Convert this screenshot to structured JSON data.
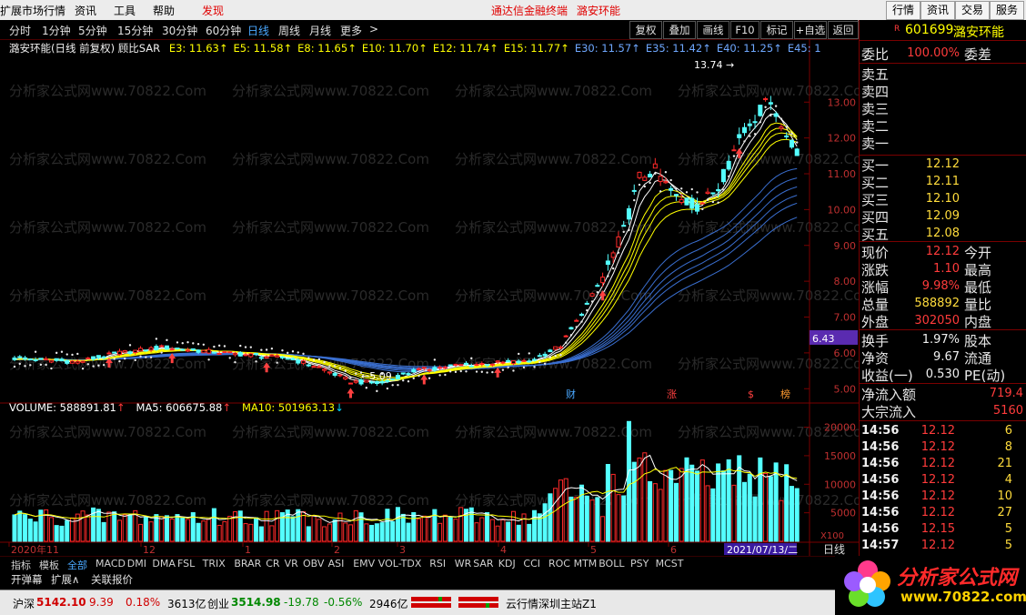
{
  "topbar": {
    "menu": [
      "扩展市场行情",
      "资讯",
      "工具",
      "帮助",
      "发现"
    ],
    "center": [
      "通达信金融终端",
      "潞安环能"
    ],
    "right_buttons": [
      "行情",
      "资讯",
      "交易",
      "服务"
    ]
  },
  "periods": [
    "分时",
    "1分钟",
    "5分钟",
    "15分钟",
    "30分钟",
    "60分钟",
    "日线",
    "周线",
    "月线",
    "更多"
  ],
  "period_active": "日线",
  "period_more_arrow": ">",
  "toolbar": [
    "复权",
    "叠加",
    "画线",
    "F10",
    "标记",
    "+自选",
    "返回"
  ],
  "stock": {
    "code": "601699",
    "name": "潞安环能",
    "badge": "R"
  },
  "ma_legend": {
    "title": "潞安环能(日线 前复权) 顾比SAR",
    "items": [
      {
        "label": "E3: 11.63",
        "arrow": "↑",
        "color": "#ffff00"
      },
      {
        "label": "E5: 11.58",
        "arrow": "↑",
        "color": "#ffff00"
      },
      {
        "label": "E8: 11.65",
        "arrow": "↑",
        "color": "#ffff00"
      },
      {
        "label": "E10: 11.70",
        "arrow": "↑",
        "color": "#ffff00"
      },
      {
        "label": "E12: 11.74",
        "arrow": "↑",
        "color": "#ffff00"
      },
      {
        "label": "E15: 11.77",
        "arrow": "↑",
        "color": "#ffff00"
      },
      {
        "label": "E30: 11.57",
        "arrow": "↑",
        "color": "#6fa8ff"
      },
      {
        "label": "E35: 11.42",
        "arrow": "↑",
        "color": "#6fa8ff"
      },
      {
        "label": "E40: 11.25",
        "arrow": "↑",
        "color": "#6fa8ff"
      },
      {
        "label": "E45: 1",
        "arrow": "",
        "color": "#6fa8ff"
      }
    ]
  },
  "price_axis": [
    "13.00",
    "12.00",
    "11.00",
    "10.00",
    "9.00",
    "8.00",
    "7.00",
    "6.00",
    "5.00"
  ],
  "price_marker": "6.43",
  "annotations": {
    "high": "13.74",
    "low": "5.09",
    "events": [
      "财",
      "涨",
      "$",
      "榜"
    ]
  },
  "volume_legend": {
    "items": [
      {
        "label": "VOLUME: 588891.81",
        "arrow": "↑",
        "color": "#ffffff"
      },
      {
        "label": "MA5: 606675.88",
        "arrow": "↑",
        "color": "#ffffff"
      },
      {
        "label": "MA10: 501963.13",
        "arrow": "↓",
        "color": "#ffff00"
      }
    ]
  },
  "volume_axis": [
    "20000",
    "15000",
    "10000",
    "5000"
  ],
  "volume_unit": "X100",
  "date_axis": [
    "2020年11",
    "12",
    "1",
    "2",
    "3",
    "4",
    "5",
    "6"
  ],
  "date_cursor": "2021/07/13/二",
  "period_label": "日线",
  "chart_data": {
    "type": "candlestick",
    "ylim": [
      4.6,
      14.2
    ],
    "high": 13.74,
    "low": 5.09,
    "volume_ylim": [
      0,
      22000
    ]
  },
  "bottom_tabs": [
    "指标",
    "模板",
    "全部",
    "MACD",
    "DMI",
    "DMA",
    "FSL",
    "TRIX",
    "BRAR",
    "CR",
    "VR",
    "OBV",
    "ASI",
    "EMV",
    "VOL-TDX",
    "RSI",
    "WR",
    "SAR",
    "KDJ",
    "CCI",
    "ROC",
    "MTM",
    "BOLL",
    "PSY",
    "MCST"
  ],
  "bottom_tab_active": "全部",
  "bottom_tabs2": [
    "开弹幕",
    "扩展∧",
    "关联报价"
  ],
  "right_panel": {
    "weibi": {
      "label": "委比",
      "value": "100.00%",
      "label2": "委差"
    },
    "sells": [
      "卖五",
      "卖四",
      "卖三",
      "卖二",
      "卖一"
    ],
    "buys": [
      {
        "label": "买一",
        "price": "12.12"
      },
      {
        "label": "买二",
        "price": "12.11"
      },
      {
        "label": "买三",
        "price": "12.10"
      },
      {
        "label": "买四",
        "price": "12.09"
      },
      {
        "label": "买五",
        "price": "12.08"
      }
    ],
    "quote": [
      {
        "l1": "现价",
        "v1": "12.12",
        "l2": "今开",
        "c": "red"
      },
      {
        "l1": "涨跌",
        "v1": "1.10",
        "l2": "最高",
        "c": "red"
      },
      {
        "l1": "涨幅",
        "v1": "9.98%",
        "l2": "最低",
        "c": "red"
      },
      {
        "l1": "总量",
        "v1": "588892",
        "l2": "量比",
        "c": "yellow"
      },
      {
        "l1": "外盘",
        "v1": "302050",
        "l2": "内盘",
        "c": "red"
      }
    ],
    "info": [
      {
        "l1": "换手",
        "v1": "1.97%",
        "l2": "股本"
      },
      {
        "l1": "净资",
        "v1": "9.67",
        "l2": "流通"
      },
      {
        "l1": "收益(一)",
        "v1": "0.530",
        "l2": "PE(动)"
      }
    ],
    "flow": [
      {
        "label": "净流入额",
        "value": "719.4"
      },
      {
        "label": "大宗流入",
        "value": "5160"
      }
    ],
    "ticks": [
      {
        "t": "14:56",
        "p": "12.12",
        "v": "6"
      },
      {
        "t": "14:56",
        "p": "12.12",
        "v": "8"
      },
      {
        "t": "14:56",
        "p": "12.12",
        "v": "21"
      },
      {
        "t": "14:56",
        "p": "12.12",
        "v": "4"
      },
      {
        "t": "14:56",
        "p": "12.12",
        "v": "10"
      },
      {
        "t": "14:56",
        "p": "12.12",
        "v": "27"
      },
      {
        "t": "14:56",
        "p": "12.15",
        "v": "5"
      },
      {
        "t": "14:57",
        "p": "12.12",
        "v": "5"
      }
    ]
  },
  "statusbar": {
    "sh_label": "沪深",
    "sh_val": "5142.10",
    "sh_chg": "9.39",
    "sh_pct": "0.18%",
    "sh_amt": "3613亿",
    "cy_label": "创业",
    "cy_val": "3514.98",
    "cy_chg": "-19.78",
    "cy_pct": "-0.56%",
    "cy_amt": "2946亿",
    "server": "云行情深圳主站Z1"
  },
  "logo": {
    "title": "分析家公式网",
    "url": "www.70822.com"
  },
  "watermark": "分析家公式网www.70822.Com"
}
